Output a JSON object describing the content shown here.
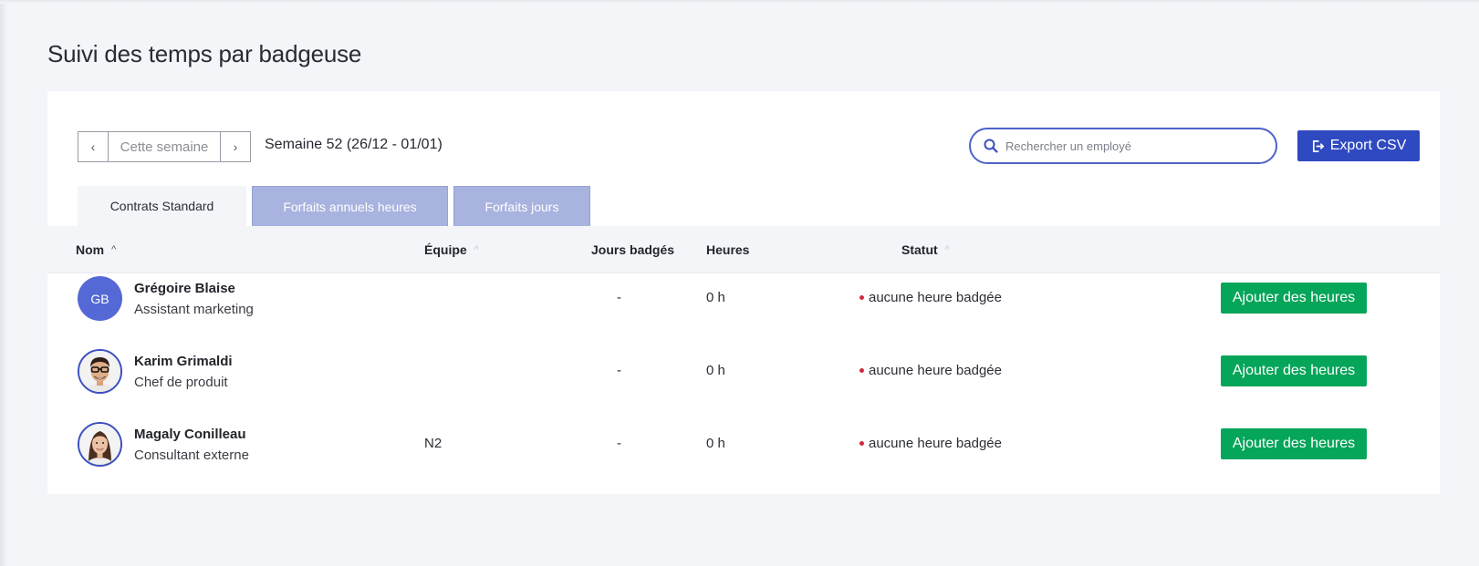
{
  "page": {
    "title": "Suivi des temps par badgeuse"
  },
  "week_nav": {
    "prev": "‹",
    "current": "Cette semaine",
    "next": "›",
    "label": "Semaine 52 (26/12 - 01/01)"
  },
  "search": {
    "placeholder": "Rechercher un employé"
  },
  "export": {
    "label": "Export CSV"
  },
  "tabs": [
    {
      "label": "Contrats Standard",
      "active": true
    },
    {
      "label": "Forfaits annuels heures",
      "active": false
    },
    {
      "label": "Forfaits jours",
      "active": false
    }
  ],
  "table": {
    "headers": {
      "name": "Nom",
      "team": "Équipe",
      "days": "Jours badgés",
      "hours": "Heures",
      "status": "Statut"
    },
    "rows": [
      {
        "initials": "GB",
        "name": "Grégoire Blaise",
        "role": "Assistant marketing",
        "team": "",
        "days": "-",
        "hours": "0 h",
        "status": "aucune heure badgée",
        "action": "Ajouter des heures"
      },
      {
        "initials": "",
        "name": "Karim Grimaldi",
        "role": "Chef de produit",
        "team": "",
        "days": "-",
        "hours": "0 h",
        "status": "aucune heure badgée",
        "action": "Ajouter des heures"
      },
      {
        "initials": "",
        "name": "Magaly Conilleau",
        "role": "Consultant externe",
        "team": "N2",
        "days": "-",
        "hours": "0 h",
        "status": "aucune heure badgée",
        "action": "Ajouter des heures"
      }
    ]
  },
  "colors": {
    "primary": "#2f49c0",
    "success": "#05a55a",
    "status_dot": "#d12b3d",
    "tab_inactive": "#a8b3df"
  },
  "icons": {
    "search": "search-icon",
    "export": "export-icon"
  }
}
